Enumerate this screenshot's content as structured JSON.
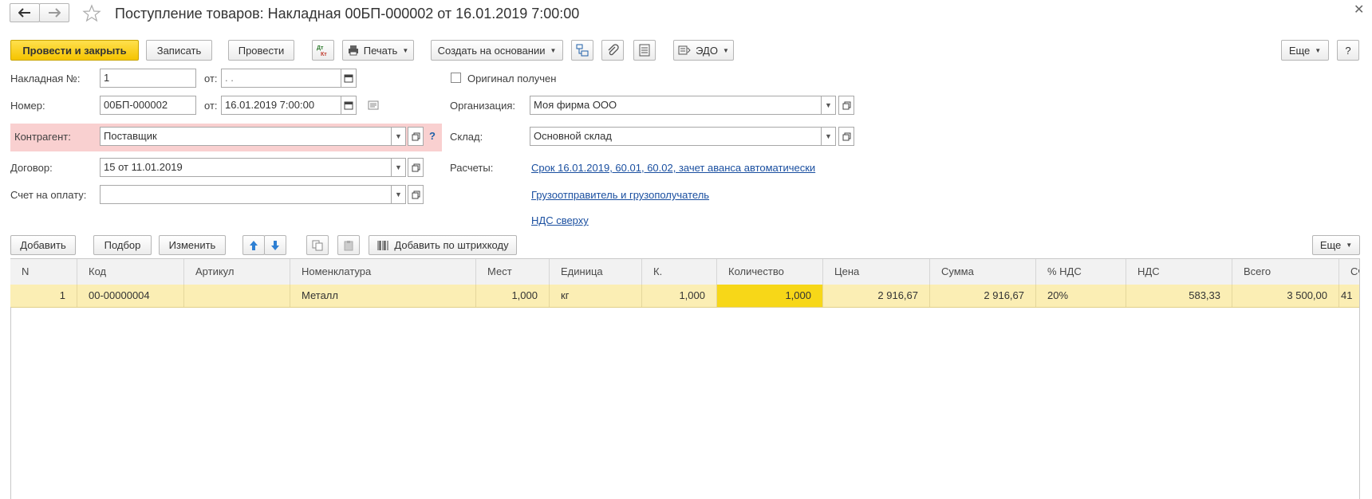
{
  "window": {
    "title": "Поступление товаров: Накладная 00БП-000002 от 16.01.2019 7:00:00"
  },
  "toolbar": {
    "post_close": "Провести и закрыть",
    "save": "Записать",
    "post": "Провести",
    "print": "Печать",
    "create_based": "Создать на основании",
    "edo": "ЭДО",
    "more": "Еще",
    "help": "?"
  },
  "form": {
    "invoice_label": "Накладная №:",
    "invoice_value": "1",
    "from_label": "от:",
    "invoice_date": " .  .",
    "number_label": "Номер:",
    "number_value": "00БП-000002",
    "number_date": "16.01.2019  7:00:00",
    "counterparty_label": "Контрагент:",
    "counterparty_value": "Поставщик",
    "contract_label": "Договор:",
    "contract_value": "15 от 11.01.2019",
    "invoice_pay_label": "Счет на оплату:",
    "invoice_pay_value": "",
    "original_label": "Оригинал получен",
    "org_label": "Организация:",
    "org_value": "Моя фирма ООО",
    "warehouse_label": "Склад:",
    "warehouse_value": "Основной склад",
    "settlements_label": "Расчеты:",
    "settlements_link": "Срок 16.01.2019, 60.01, 60.02, зачет аванса автоматически",
    "shipper_link": "Грузоотправитель и грузополучатель",
    "vat_link": "НДС сверху",
    "help_q": "?"
  },
  "table_toolbar": {
    "add": "Добавить",
    "select": "Подбор",
    "change": "Изменить",
    "barcode": "Добавить по штрихкоду",
    "more": "Еще"
  },
  "table": {
    "columns": [
      "N",
      "Код",
      "Артикул",
      "Номенклатура",
      "Мест",
      "Единица",
      "К.",
      "Количество",
      "Цена",
      "Сумма",
      "% НДС",
      "НДС",
      "Всего",
      "Сч"
    ],
    "rows": [
      [
        "1",
        "00-00000004",
        "",
        "Металл",
        "1,000",
        "кг",
        "1,000",
        "1,000",
        "2 916,67",
        "2 916,67",
        "20%",
        "583,33",
        "3 500,00",
        "41"
      ]
    ]
  }
}
